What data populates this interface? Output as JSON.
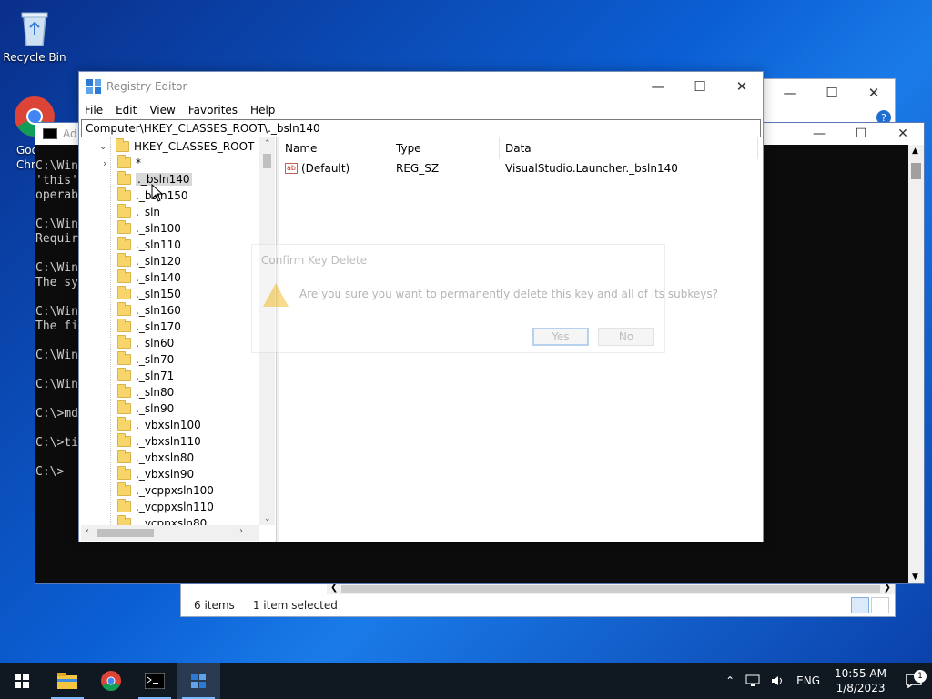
{
  "desktop": {
    "recycle_bin_label": "Recycle Bin",
    "chrome_label_line1": "Goo",
    "chrome_label_line2": "Chr"
  },
  "explorer": {
    "status_items": "6 items",
    "status_selected": "1 item selected",
    "help_icon": "?"
  },
  "console": {
    "title_prefix": "Ad",
    "lines": "C:\\Win\n'this'\noperab\n\nC:\\Win\nRequir\n\nC:\\Win\nThe sy\n\nC:\\Win\nThe fi\n\nC:\\Win\n\nC:\\Win\n\nC:\\>md\n\nC:\\>ti\n\nC:\\>"
  },
  "regedit": {
    "title": "Registry Editor",
    "menu": [
      "File",
      "Edit",
      "View",
      "Favorites",
      "Help"
    ],
    "address": "Computer\\HKEY_CLASSES_ROOT\\._bsln140",
    "tree": {
      "root": "HKEY_CLASSES_ROOT",
      "items": [
        "*",
        "._bsln140",
        "._bsln150",
        "._sln",
        "._sln100",
        "._sln110",
        "._sln120",
        "._sln140",
        "._sln150",
        "._sln160",
        "._sln170",
        "._sln60",
        "._sln70",
        "._sln71",
        "._sln80",
        "._sln90",
        "._vbxsln100",
        "._vbxsln110",
        "._vbxsln80",
        "._vbxsln90",
        "._vcppxsln100",
        "._vcppxsln110",
        "._vcppxsln80"
      ],
      "selected": "._bsln140"
    },
    "columns": [
      "Name",
      "Type",
      "Data"
    ],
    "values": [
      {
        "name": "(Default)",
        "type": "REG_SZ",
        "data": "VisualStudio.Launcher._bsln140"
      }
    ]
  },
  "dialog": {
    "title": "Confirm Key Delete",
    "message": "Are you sure you want to permanently delete this key and all of its subkeys?",
    "yes": "Yes",
    "no": "No"
  },
  "taskbar": {
    "language": "ENG",
    "time": "10:55 AM",
    "date": "1/8/2023",
    "notification_count": "1"
  }
}
